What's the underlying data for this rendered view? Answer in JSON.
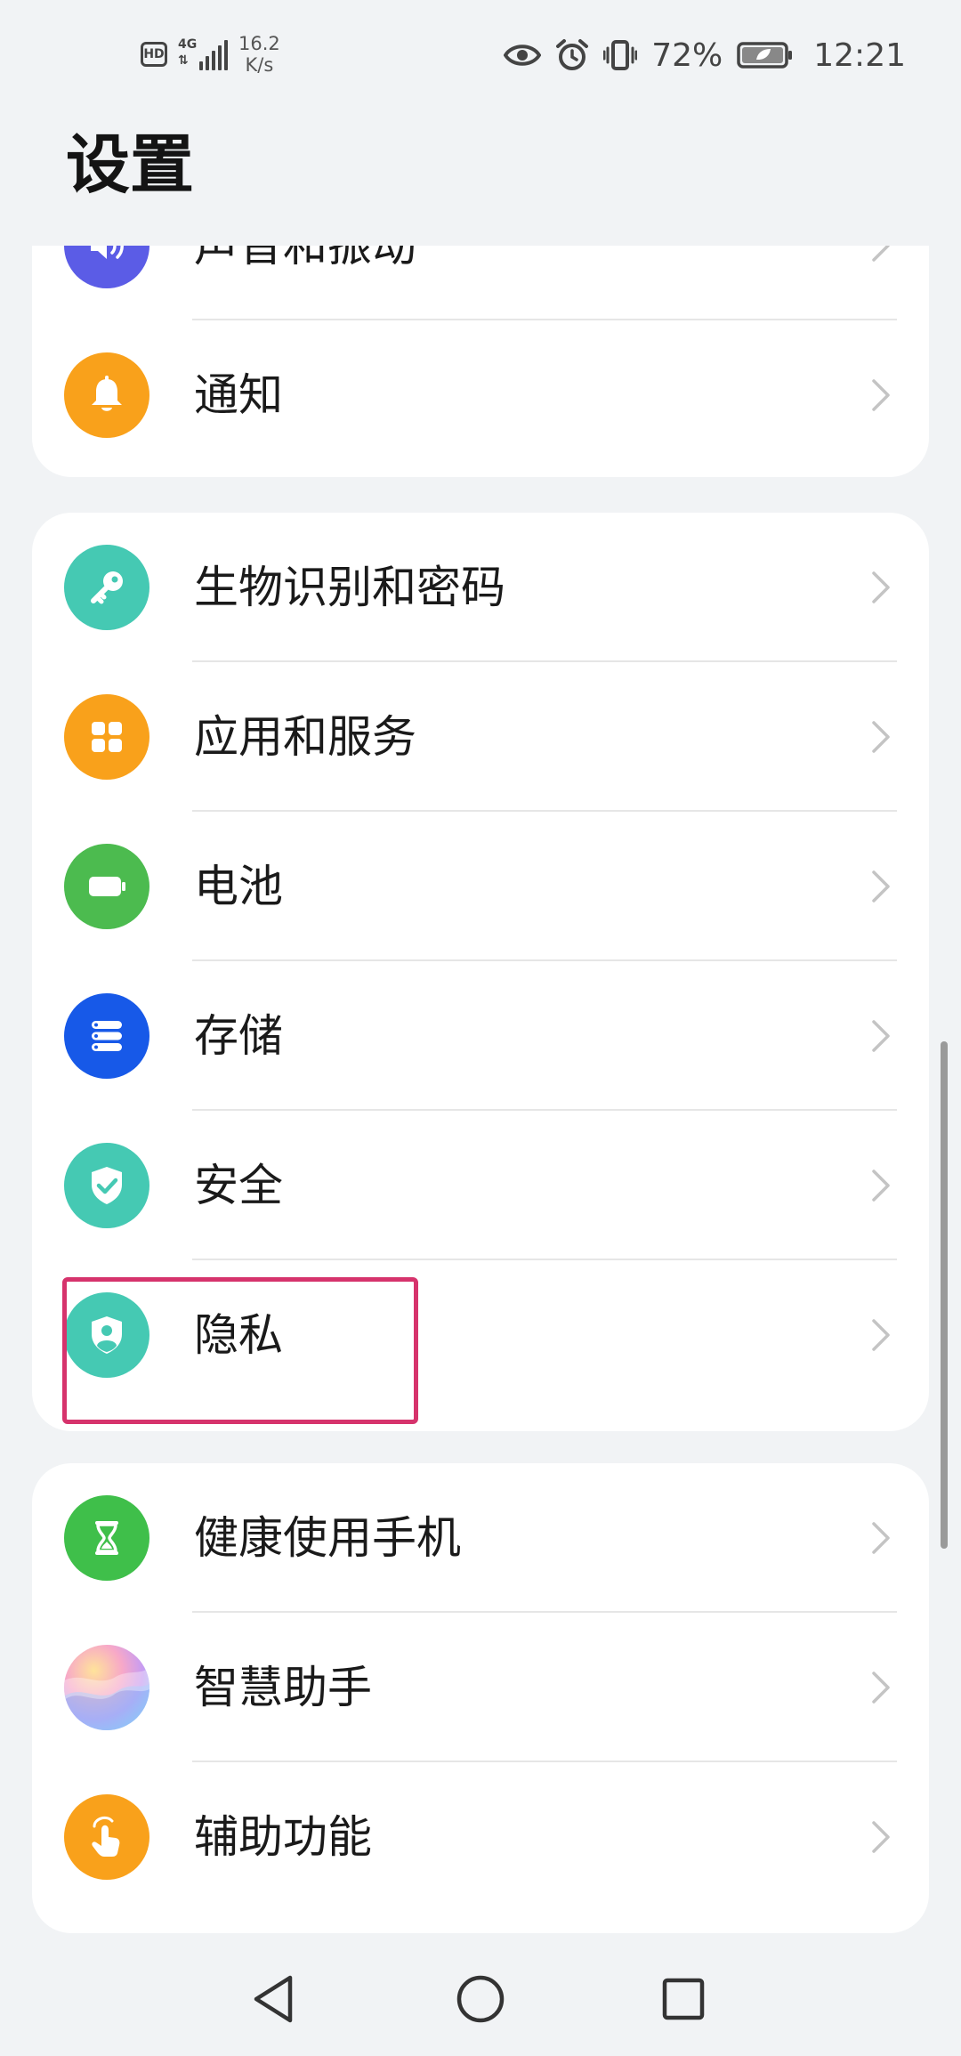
{
  "status_bar": {
    "hd": "HD",
    "network_type": "4G",
    "network_speed_value": "16.2",
    "network_speed_unit": "K/s",
    "battery_percent": "72%",
    "time": "12:21"
  },
  "header": {
    "title": "设置"
  },
  "sections": [
    {
      "items": [
        {
          "label": "声音和振动",
          "icon": "sound-icon",
          "color": "#5b5ce6"
        },
        {
          "label": "通知",
          "icon": "bell-icon",
          "color": "#f9a11b"
        }
      ]
    },
    {
      "items": [
        {
          "label": "生物识别和密码",
          "icon": "key-icon",
          "color": "#45c9b3"
        },
        {
          "label": "应用和服务",
          "icon": "apps-icon",
          "color": "#f9a11b"
        },
        {
          "label": "电池",
          "icon": "battery-icon",
          "color": "#4cbb4f"
        },
        {
          "label": "存储",
          "icon": "storage-icon",
          "color": "#1759e8"
        },
        {
          "label": "安全",
          "icon": "shield-check-icon",
          "color": "#45c9b3"
        },
        {
          "label": "隐私",
          "icon": "privacy-shield-icon",
          "color": "#45c9b3"
        }
      ]
    },
    {
      "items": [
        {
          "label": "健康使用手机",
          "icon": "hourglass-icon",
          "color": "#3fbf4a"
        },
        {
          "label": "智慧助手",
          "icon": "assistant-icon",
          "color": "#e58ab8"
        },
        {
          "label": "辅助功能",
          "icon": "hand-icon",
          "color": "#f9a11b"
        }
      ]
    }
  ]
}
